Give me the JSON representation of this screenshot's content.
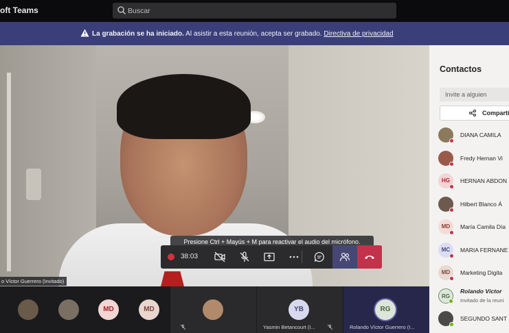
{
  "app": {
    "title": "oft Teams"
  },
  "search": {
    "placeholder": "Buscar"
  },
  "banner": {
    "bold_text": "La grabación se ha iniciado.",
    "text": " Al asistir a esta reunión, acepta ser grabado. ",
    "link": "Directiva de privacidad"
  },
  "video": {
    "speaker_tag": "o Víctor Guerrero (Invitado)",
    "toast": "Presione Ctrl + Mayús + M para reactivar el audio del micrófono."
  },
  "controls": {
    "timer": "38:03",
    "colors": {
      "recording": "#d13438",
      "people_active": "#464775",
      "hangup": "#c4314b"
    },
    "icons": [
      "camera-off-icon",
      "mic-off-icon",
      "share-screen-icon",
      "more-icon",
      "chat-icon",
      "people-icon",
      "hangup-icon"
    ]
  },
  "panel": {
    "title": "Contactos",
    "invite_placeholder": "Invite a alguien",
    "share_label": "Comparti",
    "participants": [
      {
        "name": "DIANA CAMILA",
        "initials": "",
        "status": "busy"
      },
      {
        "name": "Fredy Hernan Vi",
        "initials": "",
        "status": "busy"
      },
      {
        "name": "HERNAN ABDON",
        "initials": "HG",
        "status": "busy"
      },
      {
        "name": "Hilbert Blanco Á",
        "initials": "",
        "status": "busy"
      },
      {
        "name": "María Camila Día",
        "initials": "MD",
        "status": "busy"
      },
      {
        "name": "MARIA FERNANE",
        "initials": "MC",
        "status": "busy"
      },
      {
        "name": "Marketing Digita",
        "initials": "MD",
        "status": "busy"
      },
      {
        "name": "Rolando Víctor",
        "subtitle": "Invitado de la reuni",
        "initials": "RG",
        "status": "available"
      },
      {
        "name": "SEGUNDO SANT",
        "initials": "",
        "status": "available"
      }
    ]
  },
  "gallery": {
    "tiles": [
      {
        "initials": "",
        "name": ""
      },
      {
        "initials": "",
        "name": ""
      },
      {
        "initials": "MD",
        "name": ""
      },
      {
        "initials": "MD",
        "name": ""
      },
      {
        "initials": "",
        "name": ""
      },
      {
        "initials": "YB",
        "name": "Yasmin Betancourt (I..."
      },
      {
        "initials": "RG",
        "name": "Rolando Víctor Guerrero (I..."
      }
    ]
  }
}
